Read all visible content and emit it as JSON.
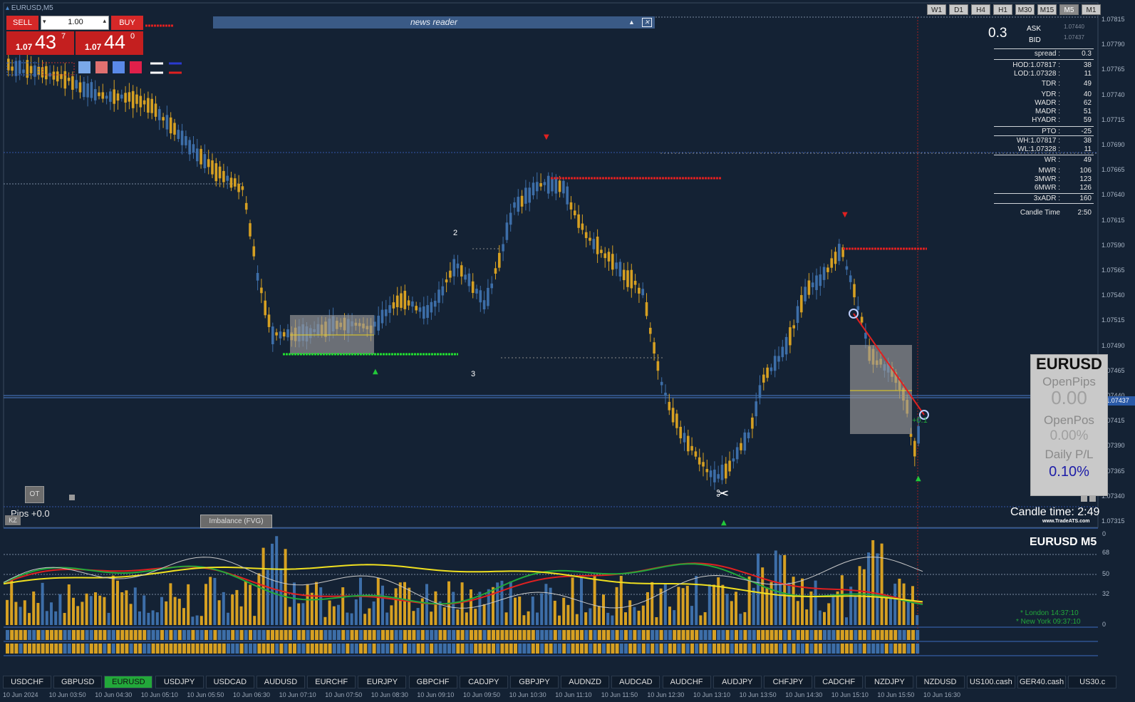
{
  "window": {
    "title": "EURUSD,M5"
  },
  "timeframes": [
    "W1",
    "D1",
    "H4",
    "H1",
    "M30",
    "M15",
    "M5",
    "M1"
  ],
  "active_timeframe": "M5",
  "trade_panel": {
    "sell_label": "SELL",
    "buy_label": "BUY",
    "lot": "1.00",
    "sell_price_prefix": "1.07",
    "sell_price_big": "43",
    "sell_price_sup": "7",
    "buy_price_prefix": "1.07",
    "buy_price_big": "44",
    "buy_price_sup": "0"
  },
  "news_reader": {
    "label": "news reader"
  },
  "price_axis": [
    "1.07615",
    "1.07790",
    "1.07765",
    "1.07740",
    "1.07715",
    "1.07690",
    "1.07665",
    "1.07640",
    "1.07615",
    "1.07590",
    "1.07565",
    "1.07540",
    "1.07515",
    "1.07490",
    "1.07465",
    "1.07440",
    "1.07415",
    "1.07390",
    "1.07365",
    "1.07340",
    "1.07315"
  ],
  "price_axis_values": [
    "1.07815",
    "1.07790",
    "1.07765",
    "1.07740",
    "1.07715",
    "1.07690",
    "1.07665",
    "1.07640",
    "1.07615",
    "1.07590",
    "1.07565",
    "1.07540",
    "1.07515",
    "1.07490",
    "1.07465",
    "1.07440",
    "1.07415",
    "1.07390",
    "1.07365",
    "1.07340",
    "1.07315"
  ],
  "current_price_tag": "1.07437",
  "stats": {
    "spread_big": "0.3",
    "ask_label": "ASK",
    "ask_value": "1.07440",
    "bid_label": "BID",
    "bid_value": "1.07437",
    "rows": [
      {
        "label": "spread :",
        "value": "0.3"
      },
      {
        "label": "HOD:1.07817 :",
        "value": "38"
      },
      {
        "label": "LOD:1.07328 :",
        "value": "11"
      },
      {
        "label": "TDR :",
        "value": "49"
      },
      {
        "label": "YDR :",
        "value": "40"
      },
      {
        "label": "WADR :",
        "value": "62"
      },
      {
        "label": "MADR :",
        "value": "51"
      },
      {
        "label": "HYADR :",
        "value": "59"
      },
      {
        "label": "PTO :",
        "value": "-25"
      },
      {
        "label": "WH:1.07817 :",
        "value": "38"
      },
      {
        "label": "WL:1.07328 :",
        "value": "11"
      },
      {
        "label": "WR :",
        "value": "49"
      },
      {
        "label": "MWR :",
        "value": "106"
      },
      {
        "label": "3MWR :",
        "value": "123"
      },
      {
        "label": "6MWR :",
        "value": "126"
      },
      {
        "label": "3xADR :",
        "value": "160"
      },
      {
        "label": "Candle Time",
        "value": "2:50"
      }
    ]
  },
  "info_panel": {
    "symbol": "EURUSD",
    "open_pips_label": "OpenPips",
    "open_pips_value": "0.00",
    "open_pos_label": "OpenPos",
    "open_pos_value": "0.00%",
    "daily_pl_label": "Daily P/L",
    "daily_pl_value": "0.10%"
  },
  "candle_time_text": "Candle time:  2:49",
  "brand": "www.TradeATS.com",
  "annotations": {
    "wave2": "2",
    "wave3": "3",
    "pips": "Pips +0.0",
    "ot": "OT",
    "kz": "KZ",
    "fvg": "Imbalance (FVG)",
    "trade_pips": "+0.1"
  },
  "sub_panel": {
    "title": "EURUSD  M5",
    "levels": [
      "0",
      "68",
      "50",
      "32",
      "0"
    ],
    "london": "* London    14:37:10",
    "newyork": "* New York   09:37:10"
  },
  "tickers": [
    "USDCHF",
    "GBPUSD",
    "EURUSD",
    "USDJPY",
    "USDCAD",
    "AUDUSD",
    "EURCHF",
    "EURJPY",
    "GBPCHF",
    "CADJPY",
    "GBPJPY",
    "AUDNZD",
    "AUDCAD",
    "AUDCHF",
    "AUDJPY",
    "CHFJPY",
    "CADCHF",
    "NZDJPY",
    "NZDUSD",
    "US100.cash",
    "GER40.cash",
    "US30.c"
  ],
  "active_ticker": "EURUSD",
  "time_labels": [
    "10 Jun 2024",
    "10 Jun 03:50",
    "10 Jun 04:30",
    "10 Jun 05:10",
    "10 Jun 05:50",
    "10 Jun 06:30",
    "10 Jun 07:10",
    "10 Jun 07:50",
    "10 Jun 08:30",
    "10 Jun 09:10",
    "10 Jun 09:50",
    "10 Jun 10:30",
    "10 Jun 11:10",
    "10 Jun 11:50",
    "10 Jun 12:30",
    "10 Jun 13:10",
    "10 Jun 13:50",
    "10 Jun 14:30",
    "10 Jun 15:10",
    "10 Jun 15:50",
    "10 Jun 16:30"
  ],
  "colors": {
    "background": "#142234",
    "bull": "#3d6ea8",
    "bear": "#d6a022",
    "red": "#e02020",
    "green": "#22c83a",
    "yellow": "#f0e020"
  }
}
